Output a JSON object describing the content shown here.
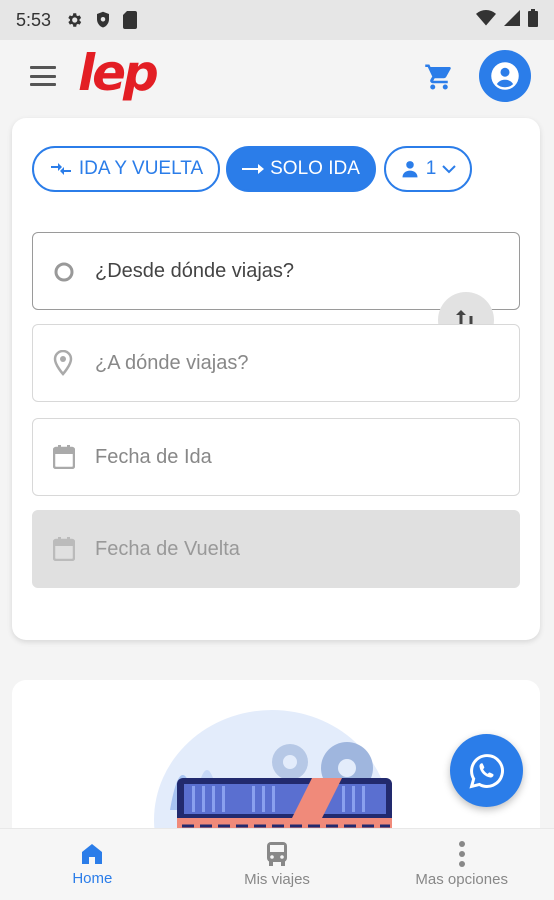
{
  "status_bar": {
    "time": "5:53"
  },
  "header": {
    "logo_text": "lep"
  },
  "trip_type": {
    "round_trip_label": "IDA Y VUELTA",
    "one_way_label": "SOLO IDA",
    "passengers_value": "1"
  },
  "form": {
    "origin_placeholder": "¿Desde dónde viajas?",
    "destination_placeholder": "¿A dónde viajas?",
    "departure_date_placeholder": "Fecha de Ida",
    "return_date_placeholder": "Fecha de Vuelta"
  },
  "bottom_nav": {
    "items": [
      {
        "label": "Home",
        "icon": "home-icon",
        "active": true
      },
      {
        "label": "Mis viajes",
        "icon": "bus-icon",
        "active": false
      },
      {
        "label": "Mas opciones",
        "icon": "more-vertical-icon",
        "active": false
      }
    ]
  },
  "colors": {
    "primary": "#2b7de9",
    "brand_red": "#e31e24",
    "whatsapp_fab": "#2b7de9"
  }
}
